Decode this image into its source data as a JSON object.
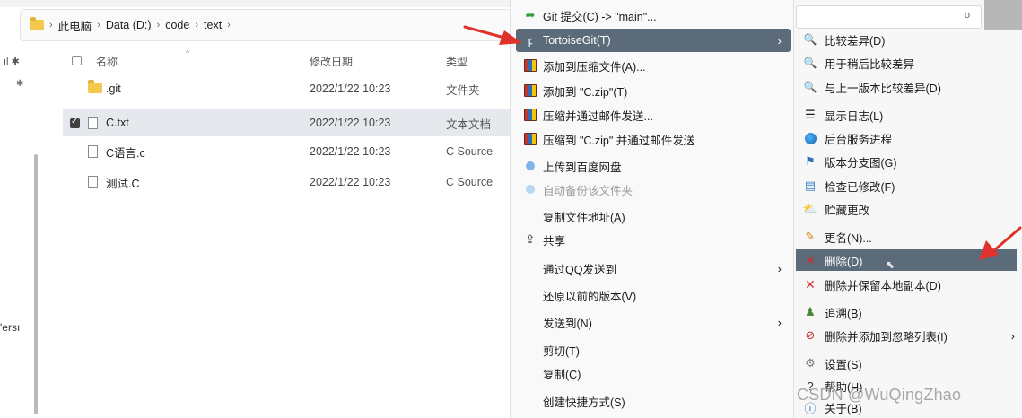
{
  "breadcrumb": [
    "此电脑",
    "Data (D:)",
    "code",
    "text"
  ],
  "nav": {
    "pin_label_1": "ıl ✱",
    "pin_label_2": "✱",
    "person_label": "'ersı"
  },
  "file_list": {
    "headers": {
      "name": "名称",
      "date": "修改日期",
      "type": "类型"
    },
    "rows": [
      {
        "name": ".git",
        "date": "2022/1/22 10:23",
        "type": "文件夹",
        "kind": "folder",
        "selected": false,
        "checked": false
      },
      {
        "name": "C.txt",
        "date": "2022/1/22 10:23",
        "type": "文本文档",
        "kind": "document",
        "selected": true,
        "checked": true
      },
      {
        "name": "C语言.c",
        "date": "2022/1/22 10:23",
        "type": "C Source",
        "kind": "document",
        "selected": false,
        "checked": false
      },
      {
        "name": "测试.C",
        "date": "2022/1/22 10:23",
        "type": "C Source",
        "kind": "document",
        "selected": false,
        "checked": false
      }
    ]
  },
  "context_menu": {
    "items": [
      {
        "label": "Git 提交(C) -> \"main\"...",
        "icon": "git-commit-icon"
      },
      {
        "label": "TortoiseGit(T)",
        "icon": "tortoisegit-icon",
        "submenu": true,
        "highlight": true
      },
      {
        "label": "添加到压缩文件(A)...",
        "icon": "winrar-icon"
      },
      {
        "label": "添加到 \"C.zip\"(T)",
        "icon": "winrar-icon"
      },
      {
        "label": "压缩并通过邮件发送...",
        "icon": "winrar-icon"
      },
      {
        "label": "压缩到 \"C.zip\" 并通过邮件发送",
        "icon": "winrar-icon"
      },
      {
        "label": "上传到百度网盘",
        "icon": "baidu-netdisk-icon"
      },
      {
        "label": "自动备份该文件夹",
        "icon": "baidu-netdisk-icon",
        "disabled": true
      },
      {
        "label": "复制文件地址(A)"
      },
      {
        "label": "共享",
        "icon": "share-icon"
      },
      {
        "label": "通过QQ发送到",
        "submenu": true
      },
      {
        "label": "还原以前的版本(V)"
      },
      {
        "label": "发送到(N)",
        "submenu": true
      },
      {
        "label": "剪切(T)"
      },
      {
        "label": "复制(C)"
      },
      {
        "label": "创建快捷方式(S)"
      }
    ]
  },
  "sub_menu": {
    "items": [
      {
        "label": "比较差异(D)",
        "icon": "diff-icon"
      },
      {
        "label": "用于稍后比较差异",
        "icon": "diff-later-icon"
      },
      {
        "label": "与上一版本比较差异(D)",
        "icon": "diff-previous-icon"
      },
      {
        "label": "显示日志(L)",
        "icon": "log-icon"
      },
      {
        "label": "后台服务进程",
        "icon": "daemon-globe-icon"
      },
      {
        "label": "版本分支图(G)",
        "icon": "revision-graph-icon"
      },
      {
        "label": "检查已修改(F)",
        "icon": "check-modifications-icon"
      },
      {
        "label": "贮藏更改",
        "icon": "stash-icon"
      },
      {
        "label": "更名(N)...",
        "icon": "rename-icon"
      },
      {
        "label": "删除(D)",
        "icon": "delete-icon",
        "highlight": true
      },
      {
        "label": "删除并保留本地副本(D)",
        "icon": "delete-keep-local-icon"
      },
      {
        "label": "追溯(B)",
        "icon": "blame-icon"
      },
      {
        "label": "删除并添加到忽略列表(I)",
        "icon": "delete-ignore-icon",
        "submenu": true
      },
      {
        "label": "设置(S)",
        "icon": "settings-icon"
      },
      {
        "label": "帮助(H)",
        "icon": "help-icon"
      },
      {
        "label": "关于(B)",
        "icon": "about-icon"
      }
    ]
  },
  "watermark": "CSDN @WuQingZhao",
  "colors": {
    "highlight": "#5b6b7a",
    "annotation_arrow": "#e0322b",
    "selected_row": "#e5e8ec"
  }
}
